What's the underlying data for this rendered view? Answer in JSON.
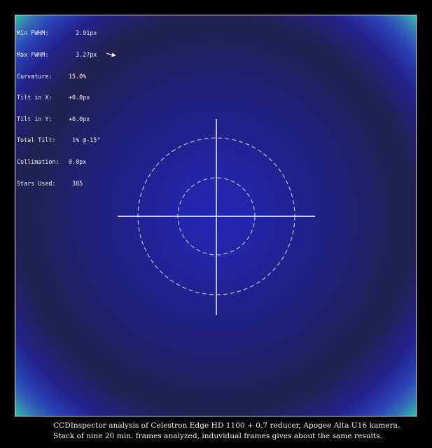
{
  "stats": [
    {
      "label": "Min FWHM:",
      "value": "  2.91px"
    },
    {
      "label": "Max FWHM:",
      "value": "  3.27px"
    },
    {
      "label": "Curvature:",
      "value": "15.0%"
    },
    {
      "label": "Tilt in X:",
      "value": "+0.0px"
    },
    {
      "label": "Tilt in Y:",
      "value": "+0.0px"
    },
    {
      "label": "Total Tilt:",
      "value": " 1% @-15°"
    },
    {
      "label": "Collimation:",
      "value": "0.0px"
    },
    {
      "label": "Stars Used:",
      "value": " 385"
    }
  ],
  "tilt_angle_deg": -15,
  "colors": {
    "background": "#000000",
    "frame_border": "#d8d8d8",
    "center_blue": "#2327b2",
    "mid_navy": "#212158",
    "corner_teal": "#2fc0a7",
    "crosshair": "#ffffff",
    "ring": "#c8c8d8"
  },
  "icons": {
    "tilt_arrow": "tilt-direction-arrow-icon",
    "crosshair": "crosshair-icon"
  },
  "caption": {
    "line1": "CCDInspector analysis of Celestron Edge HD 1100  + 0.7 reducer, Apogee Alta U16 kamera.",
    "line2": "Stack of nine 20 min. frames analyzed, induvidual frames gives about the same results."
  }
}
